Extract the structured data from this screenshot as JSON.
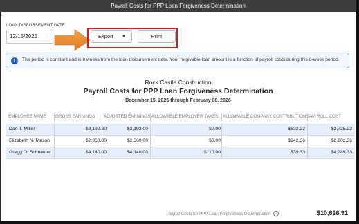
{
  "window": {
    "title": "Payroll Costs for PPP Loan Forgiveness Determination"
  },
  "filters": {
    "date_label": "LOAN DISBURSEMENT DATE",
    "date_value": "12/15/2025"
  },
  "toolbar": {
    "export_label": "Export",
    "export_caret": "▼",
    "print_label": "Print"
  },
  "info": {
    "icon": "i",
    "text": "The period is constant and is 8 weeks from the loan disbursement date. Your forgivable loan amount is a function of payroll costs during this 8-week period."
  },
  "report": {
    "company": "Rock Castle Construction",
    "title": "Payroll Costs for PPP Loan Forgiveness Determination",
    "dates": "December 15, 2025 through February 08, 2026"
  },
  "table": {
    "headers": [
      "EMPLOYEE NAME",
      "GROSS EARNINGS",
      "ADJUSTED EARNINGS",
      "ALLOWABLE EMPLOYER TAXES",
      "ALLOWABLE COMPANY CONTRIBUTIONS",
      "PAYROLL COST"
    ],
    "rows": [
      [
        "Dan T. Miller",
        "$3,192.30",
        "$3,193.00",
        "$0.00",
        "$532.22",
        "$3,725.22"
      ],
      [
        "Elizabeth N. Mason",
        "$2,360.00",
        "$2,360.00",
        "$0.00",
        "$242.36",
        "$2,602.36"
      ],
      [
        "Gregg O. Schneider",
        "$4,140.00",
        "$4,140.00",
        "$110.00",
        "$39.33",
        "$4,289.33"
      ]
    ]
  },
  "footer": {
    "label": "Payroll Costs for PPP Loan Forgiveness Determination",
    "help_icon": "?",
    "total": "$10,616.91"
  },
  "colors": {
    "highlight": "#e0141e",
    "arrow": "#f0923a",
    "row_highlight": "#e4effb",
    "info_accent": "#1d63c6"
  }
}
